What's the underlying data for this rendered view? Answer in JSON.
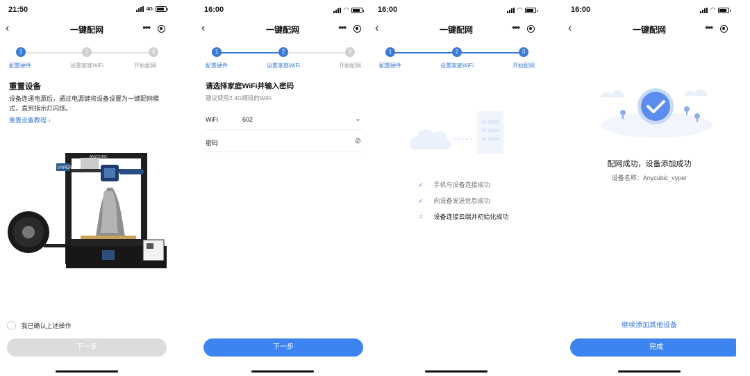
{
  "nav": {
    "title": "一键配网",
    "back_icon": "‹",
    "more_icon": "•••"
  },
  "screens": [
    {
      "status": {
        "time": "21:50",
        "network": "4G"
      },
      "steps": [
        "配置硬件",
        "设置家庭WiFi",
        "开始配网"
      ],
      "step_numbers": [
        "1",
        "2",
        "3"
      ],
      "heading": "重置设备",
      "description": "设备连通电源后，通过电源键将设备设置为一键配网模式，直到指示灯闪烁。",
      "tutorial_link": "重置设备教程 ›",
      "printer_brand": "VYPER",
      "confirm_label": "我已确认上述操作",
      "next_label": "下一步"
    },
    {
      "status": {
        "time": "16:00"
      },
      "steps": [
        "配置硬件",
        "设置家庭WiFi",
        "开始配网"
      ],
      "step_numbers": [
        "1",
        "2",
        "3"
      ],
      "heading": "请选择家庭WiFi并输入密码",
      "hint": "建议使用2.4G频段的WiFi",
      "wifi_label": "WiFi",
      "wifi_value": "602",
      "password_label": "密码",
      "next_label": "下一步"
    },
    {
      "status": {
        "time": "16:00"
      },
      "steps": [
        "配置硬件",
        "设置家庭WiFi",
        "开始配网"
      ],
      "step_numbers": [
        "1",
        "2",
        "3"
      ],
      "progress": [
        {
          "text": "手机与设备连接成功",
          "state": "done"
        },
        {
          "text": "向设备发送信息成功",
          "state": "done"
        },
        {
          "text": "设备连接云端并初始化成功",
          "state": "loading"
        }
      ]
    },
    {
      "status": {
        "time": "16:00"
      },
      "success_title": "配网成功，设备添加成功",
      "device_name": "设备名称：Anycubic_vyper",
      "add_more_link": "继续添加其他设备",
      "done_label": "完成"
    }
  ],
  "colors": {
    "accent": "#3a7bd5",
    "button": "#3d84f0",
    "disabled": "#dcdcdc"
  }
}
